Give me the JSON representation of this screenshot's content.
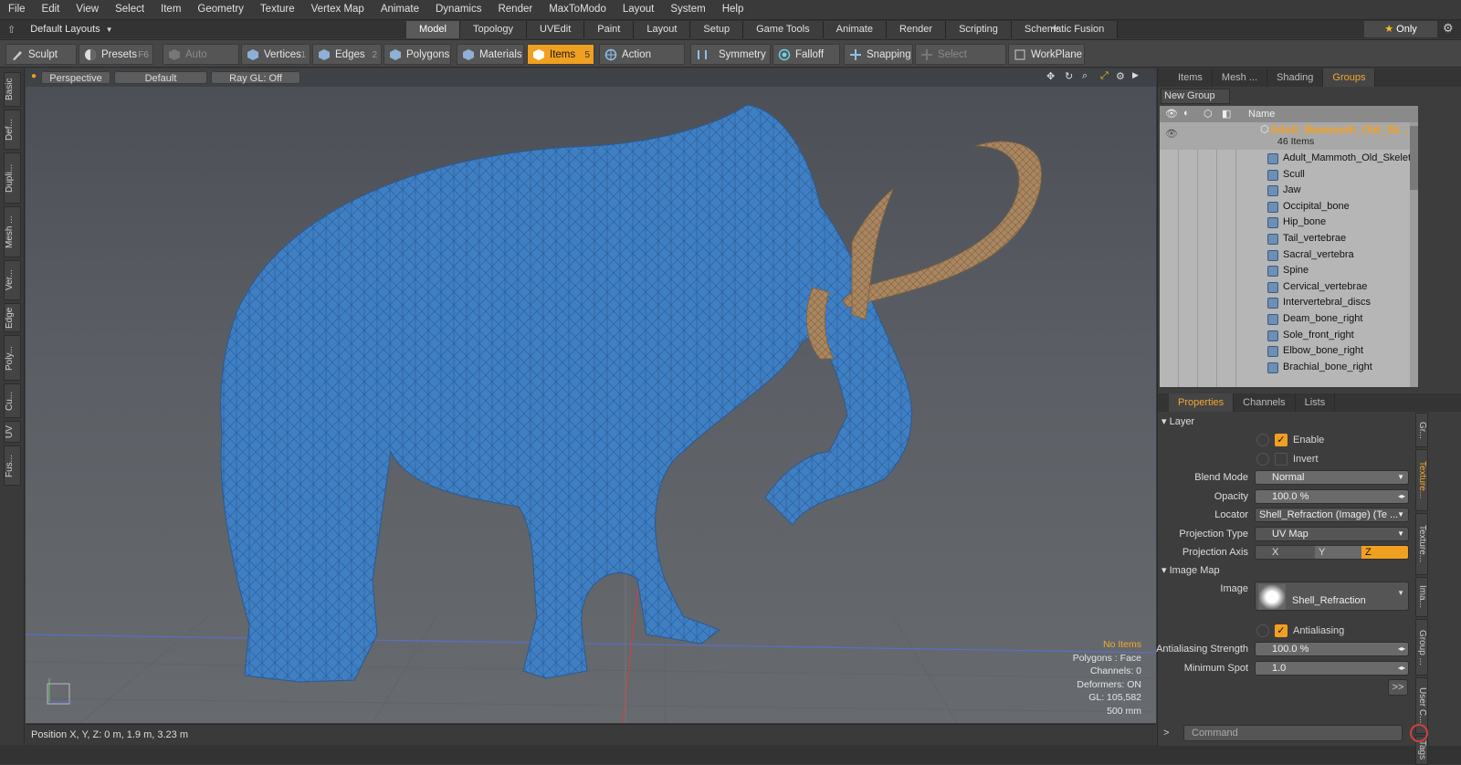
{
  "menu": [
    "File",
    "Edit",
    "View",
    "Select",
    "Item",
    "Geometry",
    "Texture",
    "Vertex Map",
    "Animate",
    "Dynamics",
    "Render",
    "MaxToModo",
    "Layout",
    "System",
    "Help"
  ],
  "layout_selector": "Default Layouts",
  "main_tabs": [
    "Model",
    "Topology",
    "UVEdit",
    "Paint",
    "Layout",
    "Setup",
    "Game Tools",
    "Animate",
    "Render",
    "Scripting",
    "Schematic Fusion"
  ],
  "active_main_tab": "Model",
  "only_label": "Only",
  "toolbar": {
    "sculpt": "Sculpt",
    "presets": "Presets",
    "presets_key": "F6",
    "auto_select": "Auto Select",
    "vertices": "Vertices",
    "vertices_key": "1",
    "edges": "Edges",
    "edges_key": "2",
    "polygons": "Polygons",
    "materials": "Materials",
    "items": "Items",
    "items_key": "5",
    "action_center": "Action Center",
    "symmetry": "Symmetry",
    "falloff": "Falloff",
    "snapping": "Snapping",
    "select_through": "Select Through",
    "workplane": "WorkPlane"
  },
  "left_tabs": [
    "Basic",
    "Def...",
    "Dupli...",
    "Mesh ...",
    "Ver...",
    "Edge",
    "Poly...",
    "Cu...",
    "UV",
    "Fus..."
  ],
  "viewport": {
    "view": "Perspective",
    "shading": "Default",
    "raygl": "Ray GL: Off",
    "info": {
      "selection": "No Items",
      "polygons": "Polygons : Face",
      "channels": "Channels: 0",
      "deformers": "Deformers: ON",
      "gl": "GL: 105,582",
      "scale": "500 mm"
    }
  },
  "status": "Position X, Y, Z:  0 m, 1.9 m, 3.23 m",
  "groups_panel": {
    "tabs": [
      "Items",
      "Mesh ...",
      "Shading",
      "Groups"
    ],
    "active_tab": "Groups",
    "new_group": "New Group",
    "column_name": "Name",
    "group_name": "Adult_Mammoth_Old_Sk ...",
    "group_count": "46 Items",
    "items": [
      "Adult_Mammoth_Old_Skelet...",
      "Scull",
      "Jaw",
      "Occipital_bone",
      "Hip_bone",
      "Tail_vertebrae",
      "Sacral_vertebra",
      "Spine",
      "Cervical_vertebrae",
      "Intervertebral_discs",
      "Deam_bone_right",
      "Sole_front_right",
      "Elbow_bone_right",
      "Brachial_bone_right"
    ]
  },
  "properties_panel": {
    "tabs": [
      "Properties",
      "Channels",
      "Lists"
    ],
    "active_tab": "Properties",
    "layer_section": "Layer",
    "enable": "Enable",
    "invert": "Invert",
    "blend_mode_label": "Blend Mode",
    "blend_mode": "Normal",
    "opacity_label": "Opacity",
    "opacity": "100.0 %",
    "locator_label": "Locator",
    "locator": "Shell_Refraction (Image) (Te ...",
    "projection_type_label": "Projection Type",
    "projection_type": "UV Map",
    "projection_axis_label": "Projection Axis",
    "axes": [
      "X",
      "Y",
      "Z"
    ],
    "active_axis": "Z",
    "image_map_section": "Image Map",
    "image_label": "Image",
    "image": "Shell_Refraction",
    "antialiasing": "Antialiasing",
    "aa_strength_label": "Antialiasing Strength",
    "aa_strength": "100.0 %",
    "min_spot_label": "Minimum Spot",
    "min_spot": "1.0",
    "side_tabs": [
      "Gr...",
      "Texture...",
      "Texture...",
      "Ima...",
      "Group ...",
      "User C...",
      "Tags"
    ]
  },
  "command_placeholder": "Command",
  "colors": {
    "accent": "#f0a020",
    "mesh": "#3f7fc4",
    "tusk": "#a98660"
  }
}
